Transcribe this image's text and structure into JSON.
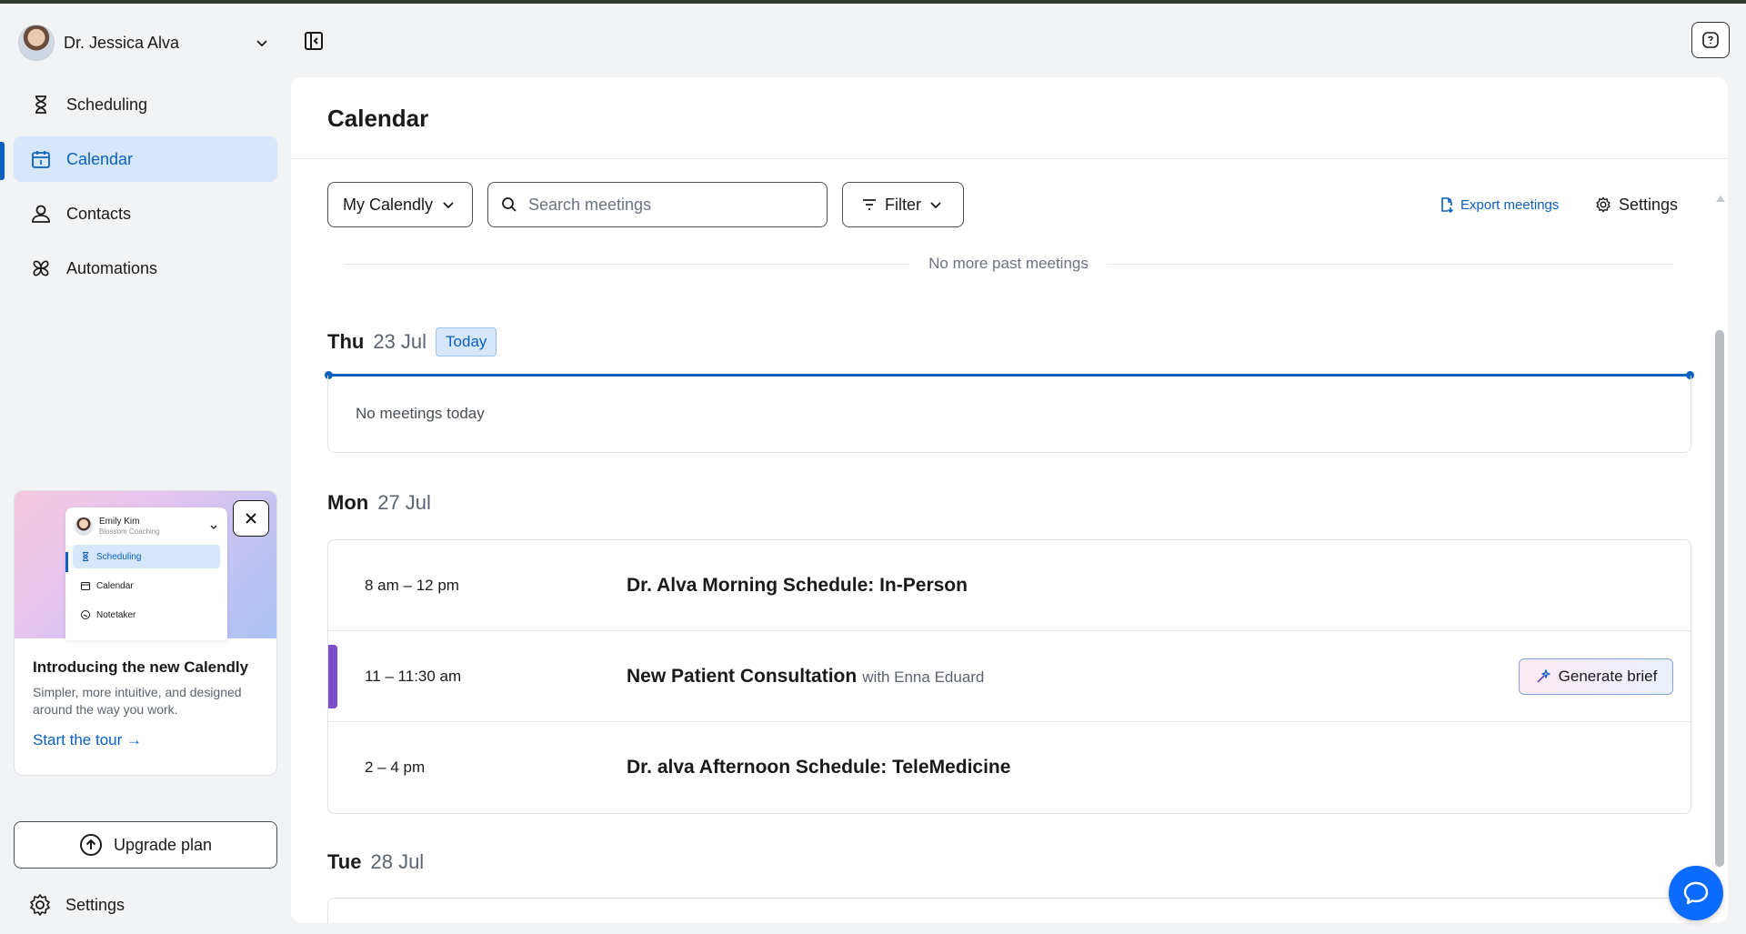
{
  "user": {
    "name": "Dr. Jessica Alva"
  },
  "nav": [
    {
      "label": "Scheduling",
      "icon": "hourglass-icon",
      "active": false
    },
    {
      "label": "Calendar",
      "icon": "calendar-icon",
      "active": true
    },
    {
      "label": "Contacts",
      "icon": "contacts-icon",
      "active": false
    },
    {
      "label": "Automations",
      "icon": "automations-icon",
      "active": false
    }
  ],
  "promo": {
    "preview": {
      "user_name": "Emily Kim",
      "user_org": "Blossom Coaching",
      "items": [
        "Scheduling",
        "Calendar",
        "Notetaker"
      ]
    },
    "title": "Introducing the new Calendly",
    "text": "Simpler, more intuitive, and designed around the way you work.",
    "link": "Start the tour →"
  },
  "sidebar_footer": {
    "upgrade_label": "Upgrade plan",
    "settings_label": "Settings"
  },
  "main": {
    "title": "Calendar",
    "toolbar": {
      "calendar_select": "My Calendly",
      "search_placeholder": "Search meetings",
      "filter_label": "Filter",
      "export_label": "Export meetings",
      "settings_label": "Settings"
    },
    "past_notice": "No more past meetings",
    "days": [
      {
        "name": "Thu",
        "date": "23 Jul",
        "badge": "Today",
        "empty_text": "No meetings today"
      },
      {
        "name": "Mon",
        "date": "27 Jul",
        "meetings": [
          {
            "time": "8 am – 12 pm",
            "title": "Dr. Alva Morning Schedule: In-Person"
          },
          {
            "time": "11 – 11:30 am",
            "title": "New Patient Consultation",
            "with": "with Enna Eduard",
            "action": "Generate brief"
          },
          {
            "time": "2 – 4 pm",
            "title": "Dr. alva Afternoon Schedule: TeleMedicine"
          }
        ]
      },
      {
        "name": "Tue",
        "date": "28 Jul"
      }
    ]
  },
  "colors": {
    "accent": "#0b5fbf",
    "active_bg": "#d6e6fb",
    "event_purple": "#7b4dc9",
    "chat": "#0b6bff"
  }
}
